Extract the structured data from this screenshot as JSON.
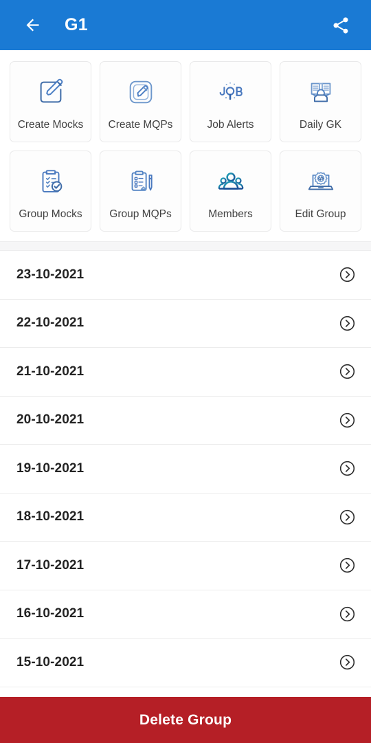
{
  "appbar": {
    "back_icon": "arrow-left-icon",
    "title": "G1",
    "share_icon": "share-icon",
    "background_color": "#1a7ad4",
    "foreground_color": "#ffffff"
  },
  "grid": {
    "tiles": [
      {
        "label": "Create Mocks",
        "icon": "note-pencil-icon"
      },
      {
        "label": "Create MQPs",
        "icon": "square-pencil-icon"
      },
      {
        "label": "Job Alerts",
        "icon": "job-search-icon"
      },
      {
        "label": "Daily GK",
        "icon": "person-reading-newspaper-icon"
      },
      {
        "label": "Group Mocks",
        "icon": "clipboard-check-icon"
      },
      {
        "label": "Group MQPs",
        "icon": "clipboard-pen-icon"
      },
      {
        "label": "Members",
        "icon": "people-group-icon"
      },
      {
        "label": "Edit Group",
        "icon": "laptop-gear-code-icon"
      }
    ]
  },
  "list": {
    "row_icon": "chevron-right-circle-icon",
    "items": [
      {
        "date": "23-10-2021"
      },
      {
        "date": "22-10-2021"
      },
      {
        "date": "21-10-2021"
      },
      {
        "date": "20-10-2021"
      },
      {
        "date": "19-10-2021"
      },
      {
        "date": "18-10-2021"
      },
      {
        "date": "17-10-2021"
      },
      {
        "date": "16-10-2021"
      },
      {
        "date": "15-10-2021"
      }
    ]
  },
  "footer": {
    "delete_label": "Delete Group",
    "delete_color": "#b51f26"
  }
}
